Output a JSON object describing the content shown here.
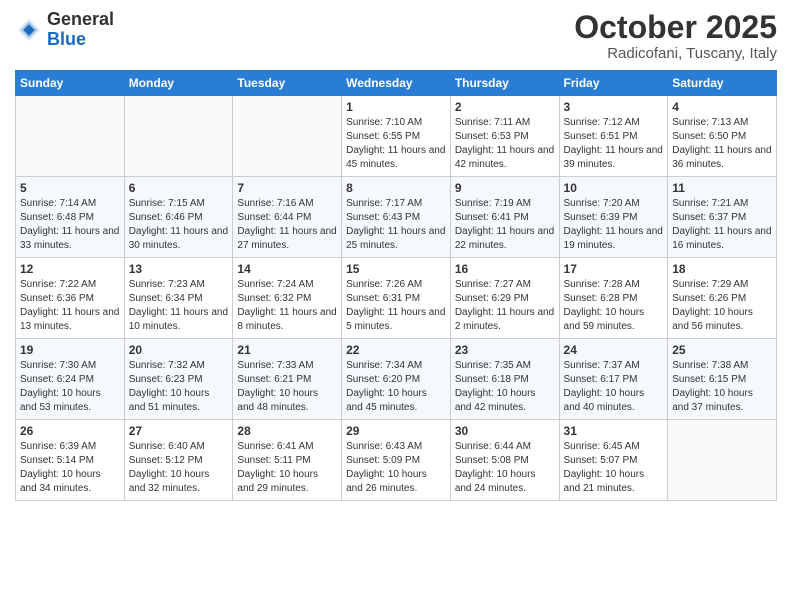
{
  "header": {
    "logo_general": "General",
    "logo_blue": "Blue",
    "month_title": "October 2025",
    "location": "Radicofani, Tuscany, Italy"
  },
  "days_of_week": [
    "Sunday",
    "Monday",
    "Tuesday",
    "Wednesday",
    "Thursday",
    "Friday",
    "Saturday"
  ],
  "weeks": [
    [
      {
        "day": "",
        "text": ""
      },
      {
        "day": "",
        "text": ""
      },
      {
        "day": "",
        "text": ""
      },
      {
        "day": "1",
        "text": "Sunrise: 7:10 AM\nSunset: 6:55 PM\nDaylight: 11 hours and 45 minutes."
      },
      {
        "day": "2",
        "text": "Sunrise: 7:11 AM\nSunset: 6:53 PM\nDaylight: 11 hours and 42 minutes."
      },
      {
        "day": "3",
        "text": "Sunrise: 7:12 AM\nSunset: 6:51 PM\nDaylight: 11 hours and 39 minutes."
      },
      {
        "day": "4",
        "text": "Sunrise: 7:13 AM\nSunset: 6:50 PM\nDaylight: 11 hours and 36 minutes."
      }
    ],
    [
      {
        "day": "5",
        "text": "Sunrise: 7:14 AM\nSunset: 6:48 PM\nDaylight: 11 hours and 33 minutes."
      },
      {
        "day": "6",
        "text": "Sunrise: 7:15 AM\nSunset: 6:46 PM\nDaylight: 11 hours and 30 minutes."
      },
      {
        "day": "7",
        "text": "Sunrise: 7:16 AM\nSunset: 6:44 PM\nDaylight: 11 hours and 27 minutes."
      },
      {
        "day": "8",
        "text": "Sunrise: 7:17 AM\nSunset: 6:43 PM\nDaylight: 11 hours and 25 minutes."
      },
      {
        "day": "9",
        "text": "Sunrise: 7:19 AM\nSunset: 6:41 PM\nDaylight: 11 hours and 22 minutes."
      },
      {
        "day": "10",
        "text": "Sunrise: 7:20 AM\nSunset: 6:39 PM\nDaylight: 11 hours and 19 minutes."
      },
      {
        "day": "11",
        "text": "Sunrise: 7:21 AM\nSunset: 6:37 PM\nDaylight: 11 hours and 16 minutes."
      }
    ],
    [
      {
        "day": "12",
        "text": "Sunrise: 7:22 AM\nSunset: 6:36 PM\nDaylight: 11 hours and 13 minutes."
      },
      {
        "day": "13",
        "text": "Sunrise: 7:23 AM\nSunset: 6:34 PM\nDaylight: 11 hours and 10 minutes."
      },
      {
        "day": "14",
        "text": "Sunrise: 7:24 AM\nSunset: 6:32 PM\nDaylight: 11 hours and 8 minutes."
      },
      {
        "day": "15",
        "text": "Sunrise: 7:26 AM\nSunset: 6:31 PM\nDaylight: 11 hours and 5 minutes."
      },
      {
        "day": "16",
        "text": "Sunrise: 7:27 AM\nSunset: 6:29 PM\nDaylight: 11 hours and 2 minutes."
      },
      {
        "day": "17",
        "text": "Sunrise: 7:28 AM\nSunset: 6:28 PM\nDaylight: 10 hours and 59 minutes."
      },
      {
        "day": "18",
        "text": "Sunrise: 7:29 AM\nSunset: 6:26 PM\nDaylight: 10 hours and 56 minutes."
      }
    ],
    [
      {
        "day": "19",
        "text": "Sunrise: 7:30 AM\nSunset: 6:24 PM\nDaylight: 10 hours and 53 minutes."
      },
      {
        "day": "20",
        "text": "Sunrise: 7:32 AM\nSunset: 6:23 PM\nDaylight: 10 hours and 51 minutes."
      },
      {
        "day": "21",
        "text": "Sunrise: 7:33 AM\nSunset: 6:21 PM\nDaylight: 10 hours and 48 minutes."
      },
      {
        "day": "22",
        "text": "Sunrise: 7:34 AM\nSunset: 6:20 PM\nDaylight: 10 hours and 45 minutes."
      },
      {
        "day": "23",
        "text": "Sunrise: 7:35 AM\nSunset: 6:18 PM\nDaylight: 10 hours and 42 minutes."
      },
      {
        "day": "24",
        "text": "Sunrise: 7:37 AM\nSunset: 6:17 PM\nDaylight: 10 hours and 40 minutes."
      },
      {
        "day": "25",
        "text": "Sunrise: 7:38 AM\nSunset: 6:15 PM\nDaylight: 10 hours and 37 minutes."
      }
    ],
    [
      {
        "day": "26",
        "text": "Sunrise: 6:39 AM\nSunset: 5:14 PM\nDaylight: 10 hours and 34 minutes."
      },
      {
        "day": "27",
        "text": "Sunrise: 6:40 AM\nSunset: 5:12 PM\nDaylight: 10 hours and 32 minutes."
      },
      {
        "day": "28",
        "text": "Sunrise: 6:41 AM\nSunset: 5:11 PM\nDaylight: 10 hours and 29 minutes."
      },
      {
        "day": "29",
        "text": "Sunrise: 6:43 AM\nSunset: 5:09 PM\nDaylight: 10 hours and 26 minutes."
      },
      {
        "day": "30",
        "text": "Sunrise: 6:44 AM\nSunset: 5:08 PM\nDaylight: 10 hours and 24 minutes."
      },
      {
        "day": "31",
        "text": "Sunrise: 6:45 AM\nSunset: 5:07 PM\nDaylight: 10 hours and 21 minutes."
      },
      {
        "day": "",
        "text": ""
      }
    ]
  ]
}
